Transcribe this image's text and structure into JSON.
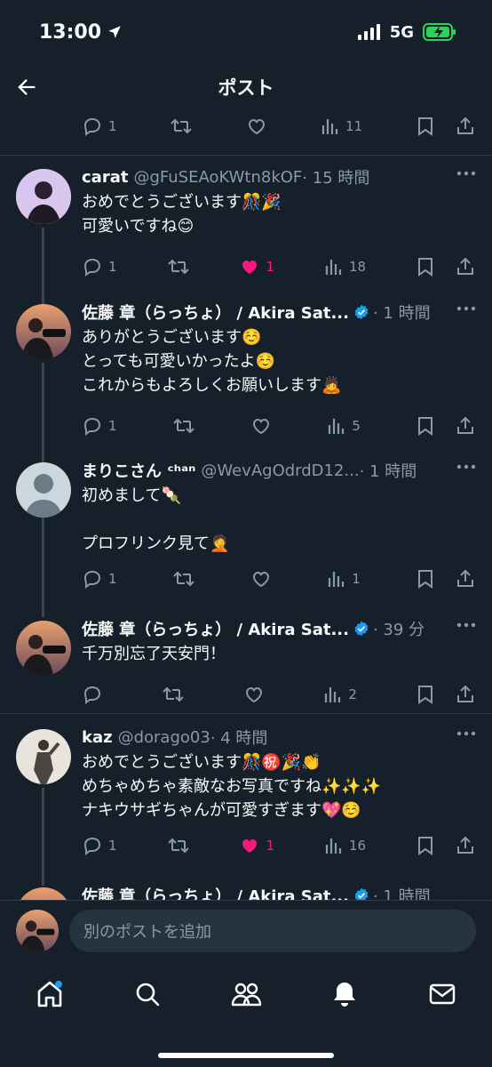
{
  "status_bar": {
    "time": "13:00",
    "network": "5G"
  },
  "header": {
    "title": "ポスト"
  },
  "top_action_bar": {
    "replies": "1",
    "views": "11"
  },
  "posts": [
    {
      "name": "carat",
      "handle": "@gFuSEAoKWtn8kOF",
      "time": "· 15 時間",
      "verified": false,
      "text": "おめでとうございます🎊🎉\n可愛いですね😊",
      "replies": "1",
      "likes": "1",
      "liked": true,
      "views": "18"
    },
    {
      "name": "佐藤 章（らっちょ） / Akira Sat...",
      "handle": "",
      "time": "· 1 時間",
      "verified": true,
      "text": "ありがとうございます☺️\nとっても可愛いかったよ☺️\nこれからもよろしくお願いします🙇",
      "replies": "1",
      "likes": "",
      "liked": false,
      "views": "5"
    },
    {
      "name": "まりこさん ᶜʰᵃⁿ",
      "handle": "@WevAgOdrdD12...",
      "time": "· 1 時間",
      "verified": false,
      "text": "初めまして🍡\n\nプロフリンク見て🤦",
      "replies": "1",
      "likes": "",
      "liked": false,
      "views": "1"
    },
    {
      "name": "佐藤 章（らっちょ） / Akira Sat...",
      "handle": "",
      "time": "· 39 分",
      "verified": true,
      "text": "千万別忘了天安門！",
      "replies": "",
      "likes": "",
      "liked": false,
      "views": "2"
    },
    {
      "name": "kaz",
      "handle": "@dorago03",
      "time": "· 4 時間",
      "verified": false,
      "text": "おめでとうございます🎊㊗️🎉👏\nめちゃめちゃ素敵なお写真ですね✨✨✨\nナキウサギちゃんが可愛すぎます💖☺️",
      "replies": "1",
      "likes": "1",
      "liked": true,
      "views": "16"
    },
    {
      "name": "佐藤 章（らっちょ） / Akira Sat...",
      "handle": "",
      "time": "· 1 時間",
      "verified": true,
      "text": "",
      "replies": "",
      "likes": "",
      "liked": false,
      "views": ""
    }
  ],
  "compose": {
    "placeholder": "別のポストを追加"
  },
  "tabs": [
    "home",
    "search",
    "communities",
    "notifications",
    "messages"
  ],
  "colors": {
    "background": "#15202b",
    "accent": "#1d9bf0",
    "like": "#f91880",
    "muted": "#8b98a5"
  }
}
